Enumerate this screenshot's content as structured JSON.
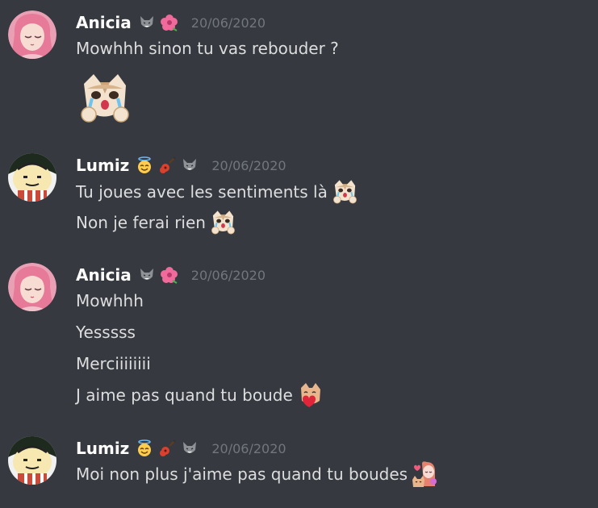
{
  "messages": [
    {
      "user": "Anicia",
      "timestamp": "20/06/2020",
      "avatar": "pink-haired-girl-avatar",
      "badges": [
        "wolf-icon",
        "hibiscus-icon"
      ],
      "lines": [
        {
          "text": "Mowhhh sinon tu vas rebouder ?",
          "emoji": null
        },
        {
          "text": "",
          "emoji": "crying-cat-emote-large"
        }
      ]
    },
    {
      "user": "Lumiz",
      "timestamp": "20/06/2020",
      "avatar": "kirby-like-character-avatar",
      "badges": [
        "angel-face-icon",
        "guitar-icon",
        "wolf-icon"
      ],
      "lines": [
        {
          "text": "Tu joues avec les sentiments là",
          "emoji": "crying-cat-emote"
        },
        {
          "text": "Non je ferai rien",
          "emoji": "crying-cat-emote"
        }
      ]
    },
    {
      "user": "Anicia",
      "timestamp": "20/06/2020",
      "avatar": "pink-haired-girl-avatar",
      "badges": [
        "wolf-icon",
        "hibiscus-icon"
      ],
      "lines": [
        {
          "text": "Mowhhh",
          "emoji": null
        },
        {
          "text": "Yesssss",
          "emoji": null
        },
        {
          "text": "Merciiiiiiii",
          "emoji": null
        },
        {
          "text": "J aime pas quand tu boude",
          "emoji": "cat-with-heart-emote"
        }
      ]
    },
    {
      "user": "Lumiz",
      "timestamp": "20/06/2020",
      "avatar": "kirby-like-character-avatar",
      "badges": [
        "angel-face-icon",
        "guitar-icon",
        "wolf-icon"
      ],
      "lines": [
        {
          "text": "Moi non plus j'aime pas quand tu boudes",
          "emoji": "girl-hugging-cat-emote"
        }
      ]
    }
  ],
  "colors": {
    "background": "#36393f",
    "username": "#ffffff",
    "timestamp": "#72767d",
    "message_text": "#dcddde"
  }
}
